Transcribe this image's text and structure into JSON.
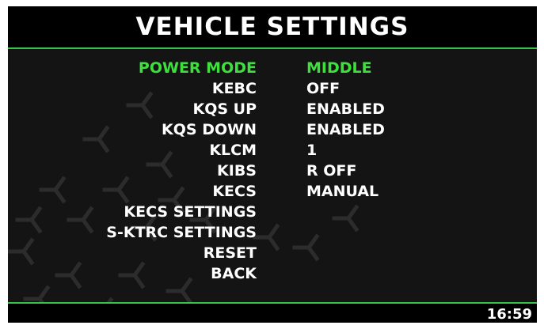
{
  "header": {
    "title": "VEHICLE SETTINGS"
  },
  "colors": {
    "accent": "#3ee03e",
    "divider": "#39c24a",
    "background": "#141414",
    "bar": "#000000",
    "text": "#ffffff"
  },
  "menu": {
    "items": [
      {
        "label": "POWER MODE",
        "value": "MIDDLE",
        "selected": true
      },
      {
        "label": "KEBC",
        "value": "OFF"
      },
      {
        "label": "KQS UP",
        "value": "ENABLED"
      },
      {
        "label": "KQS DOWN",
        "value": "ENABLED"
      },
      {
        "label": "KLCM",
        "value": "1"
      },
      {
        "label": "KIBS",
        "value": "R OFF"
      },
      {
        "label": "KECS",
        "value": "MANUAL"
      },
      {
        "label": "KECS SETTINGS",
        "value": ""
      },
      {
        "label": "S-KTRC SETTINGS",
        "value": ""
      },
      {
        "label": "RESET",
        "value": ""
      },
      {
        "label": "BACK",
        "value": ""
      }
    ]
  },
  "footer": {
    "clock": "16:59"
  }
}
